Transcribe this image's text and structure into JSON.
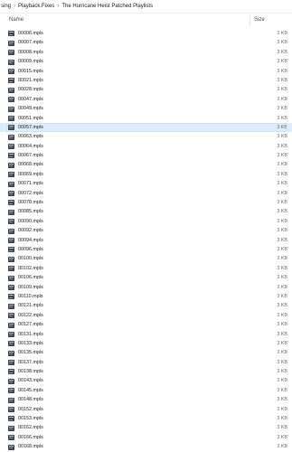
{
  "breadcrumb": {
    "items": [
      "sing",
      "Playback.Fixes",
      "The Hurricane Heist Patched Playlists"
    ],
    "separator": "›"
  },
  "columns": {
    "name": "Name",
    "size": "Size"
  },
  "selected_index": 10,
  "files": [
    {
      "name": "00006.mpls",
      "size": "3 KB"
    },
    {
      "name": "00007.mpls",
      "size": "3 KB"
    },
    {
      "name": "00008.mpls",
      "size": "3 KB"
    },
    {
      "name": "00009.mpls",
      "size": "3 KB"
    },
    {
      "name": "00015.mpls",
      "size": "3 KB"
    },
    {
      "name": "00021.mpls",
      "size": "3 KB"
    },
    {
      "name": "00028.mpls",
      "size": "3 KB"
    },
    {
      "name": "00047.mpls",
      "size": "3 KB"
    },
    {
      "name": "00049.mpls",
      "size": "3 KB"
    },
    {
      "name": "00051.mpls",
      "size": "3 KB"
    },
    {
      "name": "00057.mpls",
      "size": "3 KB"
    },
    {
      "name": "00063.mpls",
      "size": "3 KB"
    },
    {
      "name": "00064.mpls",
      "size": "3 KB"
    },
    {
      "name": "00067.mpls",
      "size": "3 KB"
    },
    {
      "name": "00068.mpls",
      "size": "3 KB"
    },
    {
      "name": "00069.mpls",
      "size": "3 KB"
    },
    {
      "name": "00071.mpls",
      "size": "3 KB"
    },
    {
      "name": "00072.mpls",
      "size": "3 KB"
    },
    {
      "name": "00078.mpls",
      "size": "3 KB"
    },
    {
      "name": "00085.mpls",
      "size": "3 KB"
    },
    {
      "name": "00090.mpls",
      "size": "3 KB"
    },
    {
      "name": "00092.mpls",
      "size": "3 KB"
    },
    {
      "name": "00094.mpls",
      "size": "3 KB"
    },
    {
      "name": "00096.mpls",
      "size": "3 KB"
    },
    {
      "name": "00100.mpls",
      "size": "3 KB"
    },
    {
      "name": "00102.mpls",
      "size": "3 KB"
    },
    {
      "name": "00106.mpls",
      "size": "3 KB"
    },
    {
      "name": "00109.mpls",
      "size": "3 KB"
    },
    {
      "name": "00110.mpls",
      "size": "3 KB"
    },
    {
      "name": "00121.mpls",
      "size": "3 KB"
    },
    {
      "name": "00122.mpls",
      "size": "3 KB"
    },
    {
      "name": "00127.mpls",
      "size": "3 KB"
    },
    {
      "name": "00131.mpls",
      "size": "3 KB"
    },
    {
      "name": "00133.mpls",
      "size": "3 KB"
    },
    {
      "name": "00135.mpls",
      "size": "3 KB"
    },
    {
      "name": "00137.mpls",
      "size": "3 KB"
    },
    {
      "name": "00138.mpls",
      "size": "3 KB"
    },
    {
      "name": "00143.mpls",
      "size": "3 KB"
    },
    {
      "name": "00145.mpls",
      "size": "3 KB"
    },
    {
      "name": "00148.mpls",
      "size": "3 KB"
    },
    {
      "name": "00152.mpls",
      "size": "3 KB"
    },
    {
      "name": "00153.mpls",
      "size": "3 KB"
    },
    {
      "name": "00162.mpls",
      "size": "3 KB"
    },
    {
      "name": "00166.mpls",
      "size": "3 KB"
    },
    {
      "name": "00168.mpls",
      "size": "3 KB"
    }
  ]
}
